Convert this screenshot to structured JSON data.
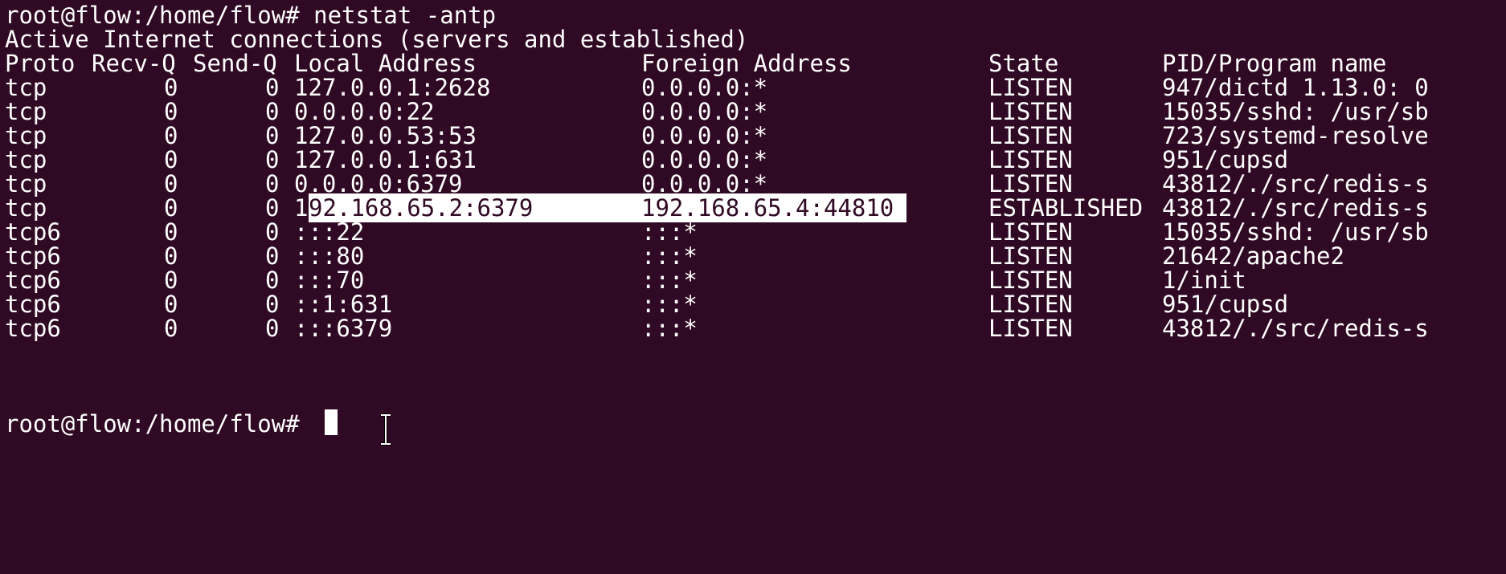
{
  "terminal": {
    "prompt": "root@flow:/home/flow# ",
    "command": "netstat -antp",
    "header_line": "Active Internet connections (servers and established)",
    "columns": {
      "proto": "Proto",
      "recvq": "Recv-Q",
      "sendq": "Send-Q",
      "local": "Local Address",
      "foreign": "Foreign Address",
      "state": "State",
      "pid": "PID/Program name"
    },
    "rows": [
      {
        "proto": "tcp",
        "recvq": "0",
        "sendq": "0",
        "local": "127.0.0.1:2628",
        "foreign": "0.0.0.0:*",
        "state": "LISTEN",
        "pid": "947/dictd 1.13.0: 0"
      },
      {
        "proto": "tcp",
        "recvq": "0",
        "sendq": "0",
        "local": "0.0.0.0:22",
        "foreign": "0.0.0.0:*",
        "state": "LISTEN",
        "pid": "15035/sshd: /usr/sb"
      },
      {
        "proto": "tcp",
        "recvq": "0",
        "sendq": "0",
        "local": "127.0.0.53:53",
        "foreign": "0.0.0.0:*",
        "state": "LISTEN",
        "pid": "723/systemd-resolve"
      },
      {
        "proto": "tcp",
        "recvq": "0",
        "sendq": "0",
        "local": "127.0.0.1:631",
        "foreign": "0.0.0.0:*",
        "state": "LISTEN",
        "pid": "951/cupsd"
      },
      {
        "proto": "tcp",
        "recvq": "0",
        "sendq": "0",
        "local": "0.0.0.0:6379",
        "foreign": "0.0.0.0:*",
        "state": "LISTEN",
        "pid": "43812/./src/redis-s"
      },
      {
        "proto": "tcp",
        "recvq": "0",
        "sendq": "0",
        "local_prefix": "1",
        "local_selected": "92.168.65.2:6379",
        "foreign": "192.168.65.4:44810",
        "state": "ESTABLISHED",
        "pid": "43812/./src/redis-s"
      },
      {
        "proto": "tcp6",
        "recvq": "0",
        "sendq": "0",
        "local": ":::22",
        "foreign": ":::*",
        "state": "LISTEN",
        "pid": "15035/sshd: /usr/sb"
      },
      {
        "proto": "tcp6",
        "recvq": "0",
        "sendq": "0",
        "local": ":::80",
        "foreign": ":::*",
        "state": "LISTEN",
        "pid": "21642/apache2"
      },
      {
        "proto": "tcp6",
        "recvq": "0",
        "sendq": "0",
        "local": ":::70",
        "foreign": ":::*",
        "state": "LISTEN",
        "pid": "1/init"
      },
      {
        "proto": "tcp6",
        "recvq": "0",
        "sendq": "0",
        "local": "::1:631",
        "foreign": ":::*",
        "state": "LISTEN",
        "pid": "951/cupsd"
      },
      {
        "proto": "tcp6",
        "recvq": "0",
        "sendq": "0",
        "local": ":::6379",
        "foreign": ":::*",
        "state": "LISTEN",
        "pid": "43812/./src/redis-s"
      }
    ],
    "final_prompt": "root@flow:/home/flow# "
  },
  "colors": {
    "background": "#300a24",
    "foreground": "#ffffff",
    "selection_bg": "#ffffff",
    "selection_fg": "#300a24"
  },
  "icons": {
    "cursor": "block-cursor-icon",
    "pointer": "ibeam-cursor-icon"
  }
}
